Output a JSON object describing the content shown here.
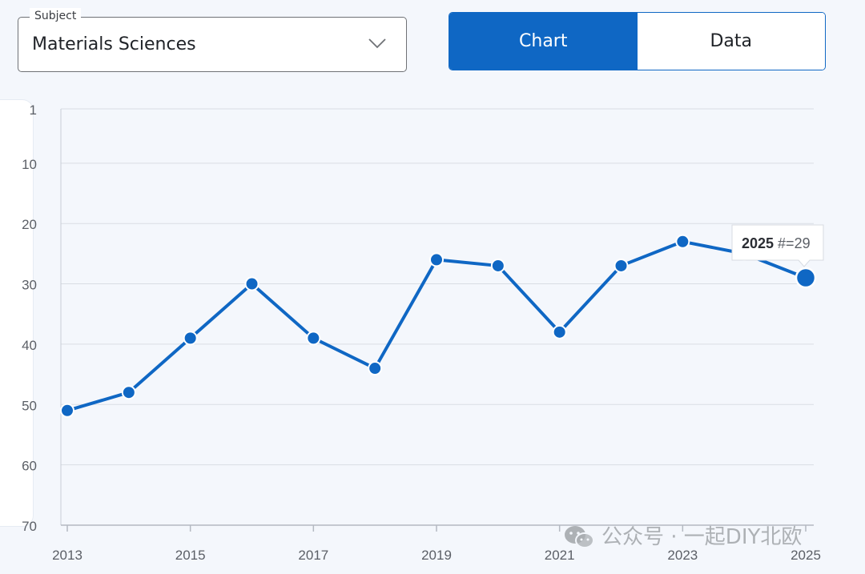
{
  "subject": {
    "legend": "Subject",
    "value": "Materials Sciences"
  },
  "toggle": {
    "chart_label": "Chart",
    "data_label": "Data",
    "active": "Chart"
  },
  "colors": {
    "accent": "#0f67c4",
    "background": "#f4f7fc",
    "grid": "#d9dde4"
  },
  "tooltip": {
    "year": "2025",
    "rank_text": "#=29"
  },
  "watermark": {
    "text": "公众号 · 一起DIY北欧",
    "icon": "wechat-icon"
  },
  "chart_data": {
    "type": "line",
    "x": [
      2013,
      2014,
      2015,
      2016,
      2017,
      2018,
      2019,
      2020,
      2021,
      2022,
      2023,
      2024,
      2025
    ],
    "series": [
      {
        "values": [
          51,
          48,
          39,
          30,
          39,
          44,
          26,
          27,
          38,
          27,
          23,
          25,
          29
        ]
      }
    ],
    "x_tick_labels": [
      "2013",
      "2015",
      "2017",
      "2019",
      "2021",
      "2023",
      "2025"
    ],
    "y_tick_labels": [
      "1",
      "10",
      "20",
      "30",
      "40",
      "50",
      "60",
      "70"
    ],
    "y_ticks": [
      1,
      10,
      20,
      30,
      40,
      50,
      60,
      70
    ],
    "ylim": [
      1,
      70
    ],
    "y_inverted": true,
    "xlim": [
      2013,
      2025
    ],
    "grid": "horizontal",
    "highlight_index": 12
  }
}
